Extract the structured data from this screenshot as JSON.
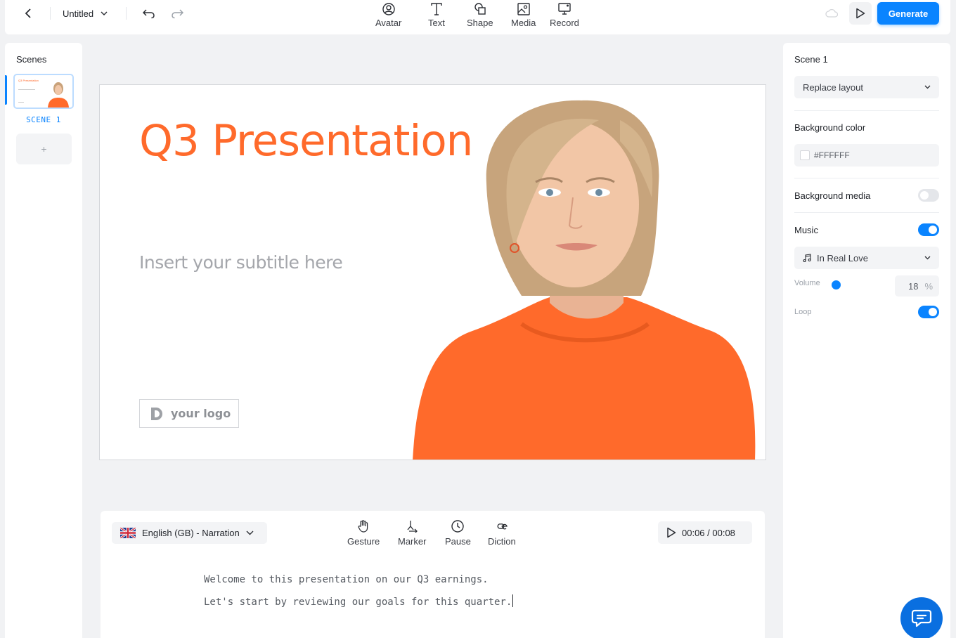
{
  "topbar": {
    "doc_title": "Untitled",
    "tools": [
      {
        "label": "Avatar",
        "icon": "avatar-icon"
      },
      {
        "label": "Text",
        "icon": "text-icon"
      },
      {
        "label": "Shape",
        "icon": "shape-icon"
      },
      {
        "label": "Media",
        "icon": "media-icon"
      },
      {
        "label": "Record",
        "icon": "record-icon"
      }
    ],
    "generate_label": "Generate"
  },
  "scenes": {
    "title": "Scenes",
    "items": [
      {
        "label": "SCENE 1",
        "thumb_title": "Q3 Presentation"
      }
    ],
    "add_label": "+"
  },
  "canvas": {
    "title": "Q3 Presentation",
    "subtitle": "Insert your subtitle here",
    "logo_text": "your logo"
  },
  "script": {
    "language": "English (GB) - Narration",
    "tools": [
      {
        "label": "Gesture",
        "icon": "hand-icon"
      },
      {
        "label": "Marker",
        "icon": "marker-icon"
      },
      {
        "label": "Pause",
        "icon": "clock-icon"
      },
      {
        "label": "Diction",
        "icon": "diction-icon"
      }
    ],
    "timer": "00:06 / 00:08",
    "lines": [
      "Welcome to this presentation on our Q3 earnings.",
      "Let's start by reviewing our goals for this quarter."
    ]
  },
  "props": {
    "scene_title": "Scene 1",
    "replace_layout": "Replace layout",
    "bg_color_label": "Background color",
    "bg_color_value": "#FFFFFF",
    "bg_media_label": "Background media",
    "bg_media_on": false,
    "music_label": "Music",
    "music_on": true,
    "music_track": "In Real Love",
    "volume_label": "Volume",
    "volume_value": "18",
    "volume_unit": "%",
    "loop_label": "Loop",
    "loop_on": true
  },
  "colors": {
    "accent": "#0a84ff",
    "brand_orange": "#ff6a2b"
  }
}
